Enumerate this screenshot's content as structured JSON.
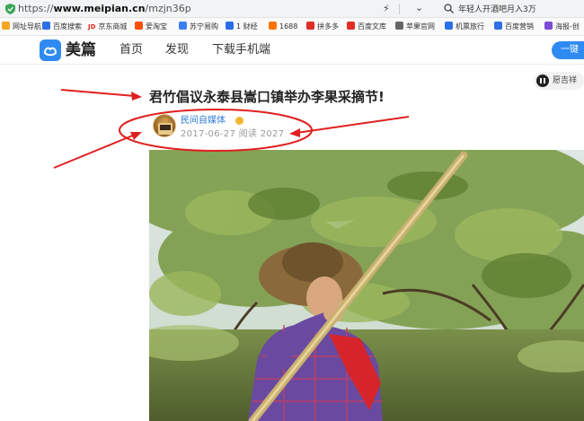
{
  "browser": {
    "url_prefix": "https://",
    "url_domain": "www.meipian.cn",
    "url_path": "/mzjn36p",
    "search_text": "年轻人开酒吧月入3万"
  },
  "bookmarks": [
    {
      "label": "网址导航",
      "color": "#f5a623",
      "glyph": ""
    },
    {
      "label": "百度搜索",
      "color": "#2e6fe6",
      "glyph": ""
    },
    {
      "label": "京东商城",
      "color": "#e1251b",
      "glyph": "JD"
    },
    {
      "label": "爱淘宝",
      "color": "#ff5000",
      "glyph": ""
    },
    {
      "label": "苏宁易购",
      "color": "#3b7ff5",
      "glyph": ""
    },
    {
      "label": "1 财经",
      "color": "#2b6be5",
      "glyph": ""
    },
    {
      "label": "1688",
      "color": "#ff7300",
      "glyph": ""
    },
    {
      "label": "拼多多",
      "color": "#e02e24",
      "glyph": ""
    },
    {
      "label": "百度文库",
      "color": "#e02e24",
      "glyph": ""
    },
    {
      "label": "苹果官网",
      "color": "#666666",
      "glyph": ""
    },
    {
      "label": "机票旅行",
      "color": "#2e6fe6",
      "glyph": ""
    },
    {
      "label": "百度营销",
      "color": "#2e6fe6",
      "glyph": ""
    },
    {
      "label": "海报-创",
      "color": "#7b4bd6",
      "glyph": ""
    }
  ],
  "site": {
    "brand": "美篇",
    "nav": [
      "首页",
      "发现",
      "下载手机端"
    ],
    "cta": "一键",
    "brand_color": "#2f8bf2"
  },
  "article": {
    "title": "君竹倡议永泰县嵩口镇举办李果采摘节!",
    "audio_label": "愿吉祥",
    "author": "民间自媒体",
    "date": "2017-06-27",
    "reads_label": "阅读",
    "reads": "2027"
  },
  "annotation_color": "#e02020"
}
